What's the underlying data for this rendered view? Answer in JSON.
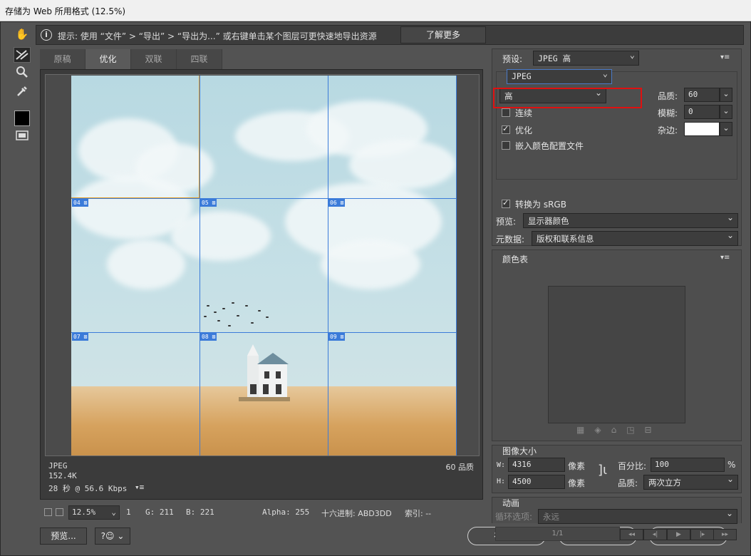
{
  "window": {
    "title": "存储为 Web 所用格式 (12.5%)"
  },
  "hint": {
    "text": "提示: 使用 “文件” > “导出” > “导出为...” 或右键单击某个图层可更快速地导出资源",
    "learn_more": "了解更多"
  },
  "tabs": [
    {
      "label": "原稿"
    },
    {
      "label": "优化"
    },
    {
      "label": "双联"
    },
    {
      "label": "四联"
    }
  ],
  "slices": [
    "04",
    "05",
    "06",
    "07",
    "08",
    "09"
  ],
  "canvas_info": {
    "format": "JPEG",
    "size": "152.4K",
    "speed": "28 秒 @ 56.6 Kbps",
    "quality": "60 品质"
  },
  "statusbar": {
    "zoom": "12.5%",
    "r": "1",
    "g": "G: 211",
    "b": "B: 221",
    "alpha": "Alpha: 255",
    "hex": "十六进制: ABD3DD",
    "index": "索引: --"
  },
  "buttons": {
    "preview": "预览...",
    "save": "存储...",
    "cancel": "取消",
    "done": "完成"
  },
  "settings": {
    "preset_label": "预设:",
    "preset_value": "JPEG 高",
    "format": "JPEG",
    "quality_level": "高",
    "quality_label": "品质:",
    "quality_value": "60",
    "blur_label": "模糊:",
    "blur_value": "0",
    "matte_label": "杂边:",
    "progressive": {
      "label": "连续",
      "checked": false
    },
    "optimized": {
      "label": "优化",
      "checked": true
    },
    "embed_profile": {
      "label": "嵌入颜色配置文件",
      "checked": false
    },
    "convert_srgb": {
      "label": "转换为 sRGB",
      "checked": true
    },
    "preview_label": "预览:",
    "preview_value": "显示器颜色",
    "metadata_label": "元数据:",
    "metadata_value": "版权和联系信息"
  },
  "color_table": {
    "title": "颜色表"
  },
  "image_size": {
    "title": "图像大小",
    "w_label": "W:",
    "w_value": "4316",
    "h_label": "H:",
    "h_value": "4500",
    "unit": "像素",
    "percent_label": "百分比:",
    "percent_value": "100",
    "percent_unit": "%",
    "quality_label": "品质:",
    "quality_value": "两次立方"
  },
  "animation": {
    "title": "动画",
    "loop_label": "循环选项:",
    "loop_value": "永远",
    "frame": "1/1"
  }
}
